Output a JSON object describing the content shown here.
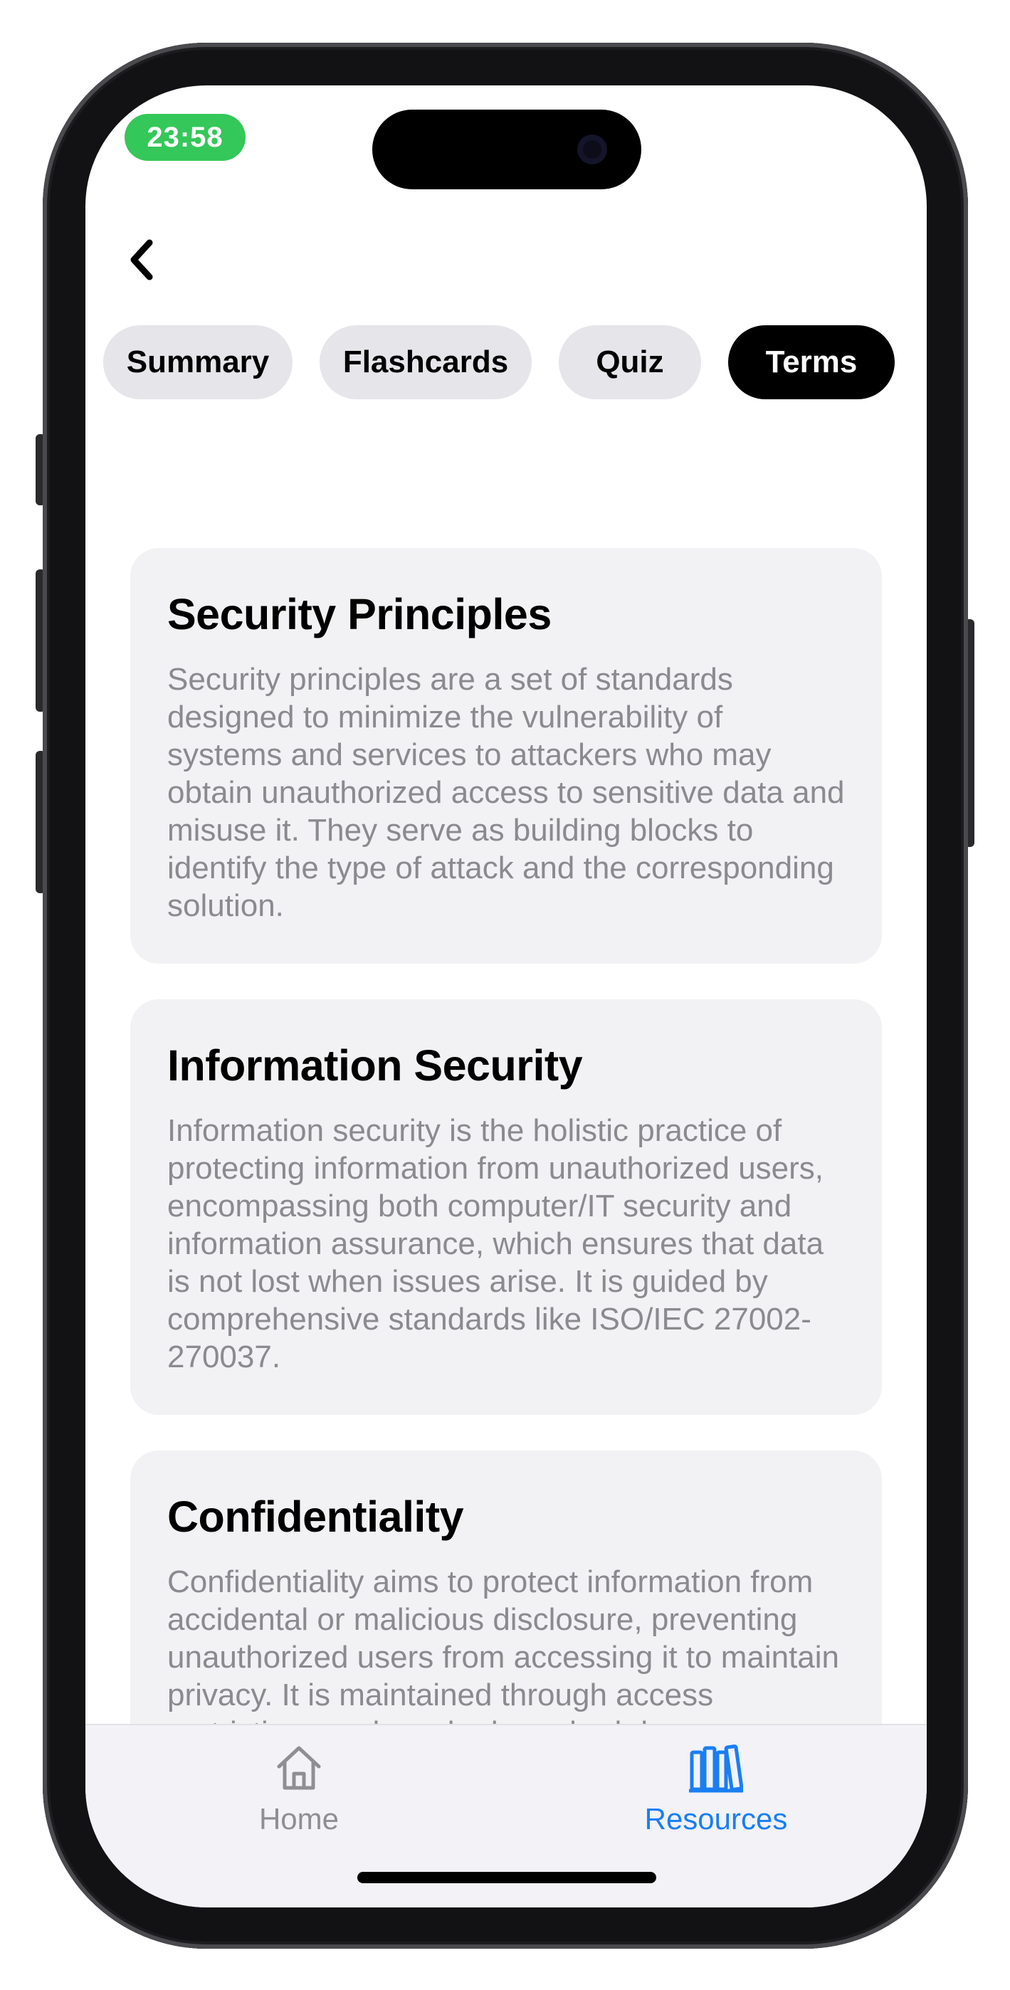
{
  "status_bar": {
    "time": "23:58"
  },
  "nav": {
    "back_icon": "chevron-left-icon"
  },
  "tabs": [
    {
      "label": "Summary",
      "active": false
    },
    {
      "label": "Flashcards",
      "active": false
    },
    {
      "label": "Quiz",
      "active": false
    },
    {
      "label": "Terms",
      "active": true
    }
  ],
  "terms": [
    {
      "title": "Security Principles",
      "description": "Security principles are a set of standards designed to minimize the vulnerability of systems and services to attackers who may obtain unauthorized access to sensitive data and misuse it. They serve as building blocks to identify the type of attack and the corresponding solution."
    },
    {
      "title": "Information Security",
      "description": "Information security is the holistic practice of protecting information from unauthorized users, encompassing both computer/IT security and information assurance, which ensures that data is not lost when issues arise. It is guided by comprehensive standards like ISO/IEC 27002-270037."
    },
    {
      "title": "Confidentiality",
      "description": "Confidentiality aims to protect information from accidental or malicious disclosure, preventing unauthorized users from accessing it to maintain privacy. It is maintained through access restrictions and can be breached due"
    }
  ],
  "tab_bar": {
    "items": [
      {
        "label": "Home",
        "icon": "house-icon",
        "active": false
      },
      {
        "label": "Resources",
        "icon": "books-icon",
        "active": true
      }
    ]
  },
  "colors": {
    "accent": "#1a7ef2",
    "inactive": "#8e8e93",
    "status_pill": "#34c759"
  }
}
